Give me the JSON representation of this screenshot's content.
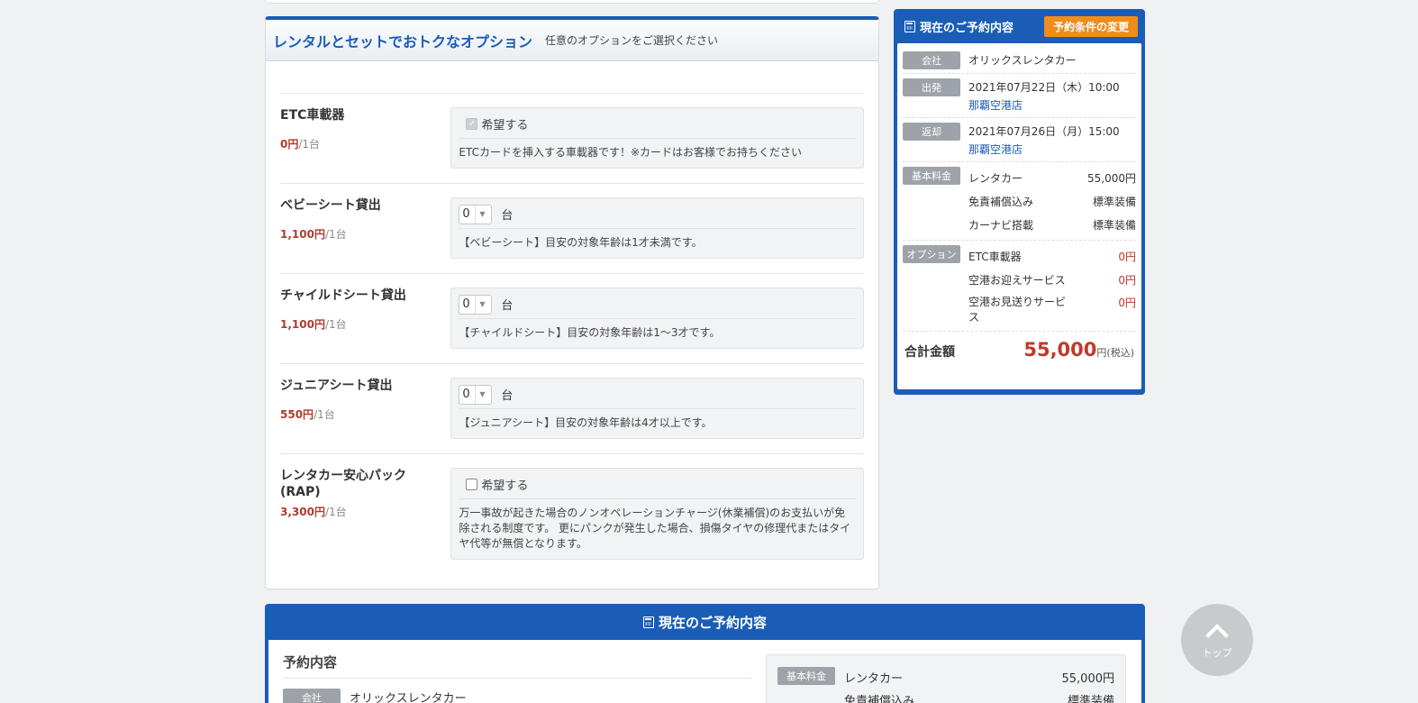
{
  "options_panel": {
    "title": "レンタルとセットでおトクなオプション",
    "subtitle": "任意のオプションをご選択ください",
    "rows": [
      {
        "name": "ETC車載器",
        "price": "0円",
        "per": "/1台",
        "control": "checkbox",
        "checked": true,
        "label": "希望する",
        "desc": "ETCカードを挿入する車載器です！※カードはお客様でお持ちください"
      },
      {
        "name": "ベビーシート貸出",
        "price": "1,100円",
        "per": "/1台",
        "control": "select",
        "value": "0",
        "unit": "台",
        "desc": "【ベビーシート】目安の対象年齢は1才未満です。"
      },
      {
        "name": "チャイルドシート貸出",
        "price": "1,100円",
        "per": "/1台",
        "control": "select",
        "value": "0",
        "unit": "台",
        "desc": "【チャイルドシート】目安の対象年齢は1～3才です。"
      },
      {
        "name": "ジュニアシート貸出",
        "price": "550円",
        "per": "/1台",
        "control": "select",
        "value": "0",
        "unit": "台",
        "desc": "【ジュニアシート】目安の対象年齢は4才以上です。"
      },
      {
        "name": "レンタカー安心パック(RAP)",
        "price": "3,300円",
        "per": "/1台",
        "control": "checkbox",
        "checked": false,
        "label": "希望する",
        "desc": "万一事故が起きた場合のノンオペレーションチャージ(休業補償)のお支払いが免除される制度です。 更にパンクが発生した場合、損傷タイヤの修理代またはタイヤ代等が無償となります。"
      }
    ]
  },
  "sidebar": {
    "title": "現在のご予約内容",
    "change_button": "予約条件の変更",
    "company_tag": "会社",
    "company": "オリックスレンタカー",
    "depart_tag": "出発",
    "depart_datetime": "2021年07月22日（木）10:00",
    "depart_store": "那覇空港店",
    "return_tag": "返却",
    "return_datetime": "2021年07月26日（月）15:00",
    "return_store": "那覇空港店",
    "basic_tag": "基本料金",
    "basic_items": [
      {
        "label": "レンタカー",
        "value": "55,000円"
      },
      {
        "label": "免責補償込み",
        "value": "標準装備"
      },
      {
        "label": "カーナビ搭載",
        "value": "標準装備"
      }
    ],
    "option_tag": "オプション",
    "option_items": [
      {
        "label": "ETC車載器",
        "value": "0円"
      },
      {
        "label": "空港お迎えサービス",
        "value": "0円"
      },
      {
        "label": "空港お見送りサービス",
        "value": "0円"
      }
    ],
    "total_label": "合計金額",
    "total_amount": "55,000",
    "total_unit": "円(税込)"
  },
  "bottom": {
    "title": "現在のご予約内容",
    "section_title": "予約内容",
    "company_tag": "会社",
    "company": "オリックスレンタカー",
    "basic_tag": "基本料金",
    "basic_label": "レンタカー",
    "basic_value": "55,000円",
    "line2_label": "免責補償込み",
    "line2_value": "標準装備"
  },
  "to_top_label": "トップ",
  "colors": {
    "brand_blue": "#1a5db7",
    "accent_orange": "#f08c1a",
    "price_red": "#c0392b"
  }
}
